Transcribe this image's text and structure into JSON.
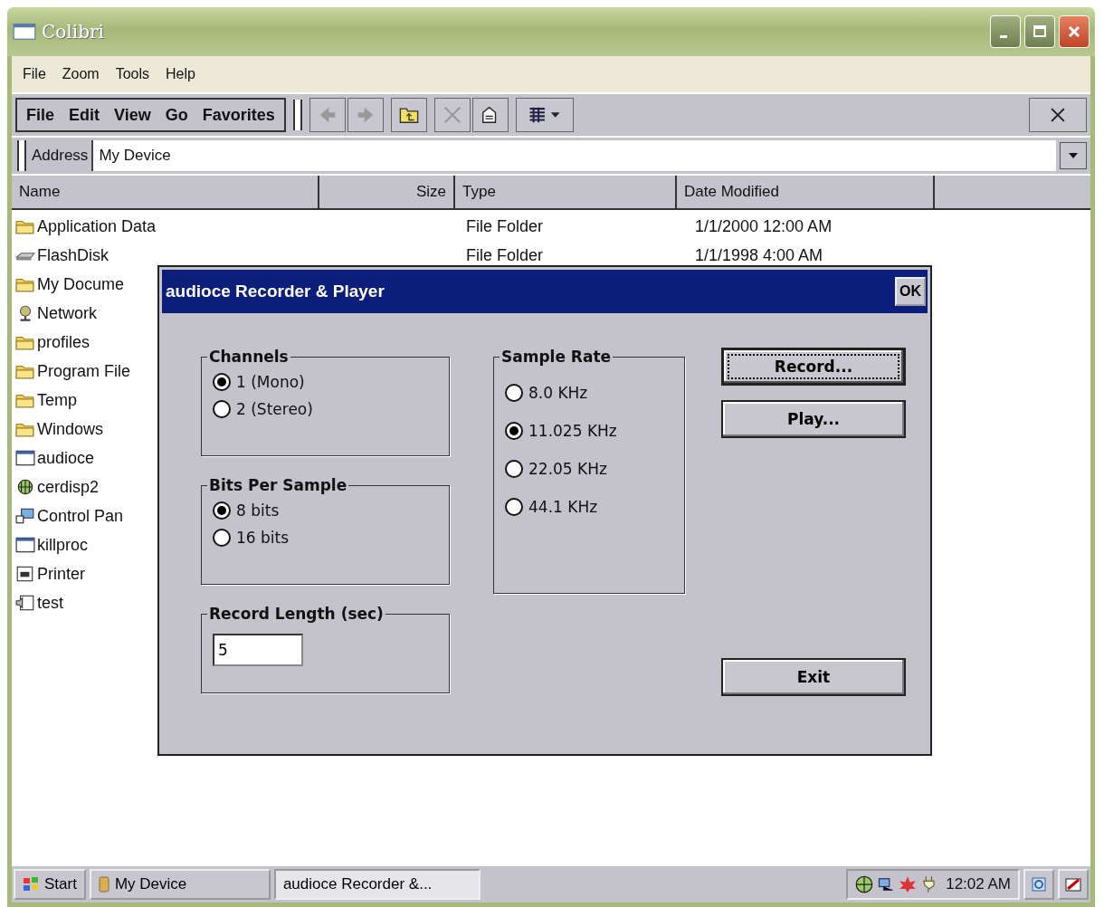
{
  "window": {
    "title": "Colibri"
  },
  "menu": [
    "File",
    "Zoom",
    "Tools",
    "Help"
  ],
  "toolbar": {
    "menus": [
      "File",
      "Edit",
      "View",
      "Go",
      "Favorites"
    ],
    "buttons": [
      {
        "kind": "back",
        "disabled": true
      },
      {
        "kind": "forward",
        "disabled": true
      },
      {
        "kind": "up",
        "disabled": false
      },
      {
        "kind": "delete",
        "disabled": true
      },
      {
        "kind": "properties",
        "disabled": false
      },
      {
        "kind": "views",
        "disabled": false
      }
    ]
  },
  "address": {
    "label": "Address",
    "value": "My Device"
  },
  "columns": [
    "Name",
    "Size",
    "Type",
    "Date Modified"
  ],
  "rows": [
    {
      "kind": "folder",
      "name": "Application Data",
      "type": "File Folder",
      "date": "1/1/2000 12:00 AM"
    },
    {
      "kind": "drive",
      "name": "FlashDisk",
      "type": "File Folder",
      "date": "1/1/1998 4:00 AM"
    },
    {
      "kind": "folder",
      "name": "My Docume"
    },
    {
      "kind": "network",
      "name": "Network"
    },
    {
      "kind": "folder",
      "name": "profiles"
    },
    {
      "kind": "folder",
      "name": "Program File"
    },
    {
      "kind": "folder",
      "name": "Temp"
    },
    {
      "kind": "folder",
      "name": "Windows"
    },
    {
      "kind": "app",
      "name": "audioce"
    },
    {
      "kind": "display",
      "name": "cerdisp2"
    },
    {
      "kind": "control",
      "name": "Control Pan"
    },
    {
      "kind": "app",
      "name": "killproc"
    },
    {
      "kind": "printer",
      "name": "Printer"
    },
    {
      "kind": "sound",
      "name": "test"
    }
  ],
  "dialog": {
    "title": "audioce Recorder & Player",
    "ok": "OK",
    "channels": {
      "title": "Channels",
      "options": [
        {
          "label": "1 (Mono)",
          "selected": true
        },
        {
          "label": "2 (Stereo)",
          "selected": false
        }
      ]
    },
    "bits": {
      "title": "Bits Per Sample",
      "options": [
        {
          "label": "8 bits",
          "selected": true
        },
        {
          "label": "16 bits",
          "selected": false
        }
      ]
    },
    "record_length": {
      "title": "Record Length (sec)",
      "value": "5"
    },
    "sample_rate": {
      "title": "Sample Rate",
      "options": [
        {
          "label": "8.0 KHz",
          "selected": false
        },
        {
          "label": "11.025 KHz",
          "selected": true
        },
        {
          "label": "22.05 KHz",
          "selected": false
        },
        {
          "label": "44.1 KHz",
          "selected": false
        }
      ]
    },
    "buttons": [
      {
        "label": "Record...",
        "focused": true
      },
      {
        "label": "Play...",
        "focused": false
      },
      {
        "label": "Exit",
        "focused": false
      }
    ]
  },
  "taskbar": {
    "start": "Start",
    "tasks": [
      {
        "label": "My Device",
        "selected": false
      },
      {
        "label": "audioce Recorder &...",
        "selected": true
      }
    ],
    "clock": "12:02 AM"
  }
}
